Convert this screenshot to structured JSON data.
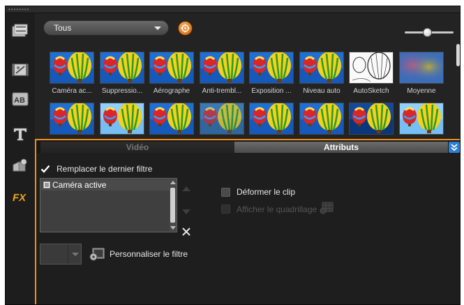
{
  "library": {
    "category_select": "Tous",
    "zoom": {
      "level": 0.45
    },
    "thumbnails": [
      {
        "label": "Caméra ac...",
        "style": "balloon"
      },
      {
        "label": "Suppressio...",
        "style": "balloon"
      },
      {
        "label": "Aérographe",
        "style": "balloon"
      },
      {
        "label": "Anti-trembl...",
        "style": "balloon"
      },
      {
        "label": "Exposition ...",
        "style": "balloon"
      },
      {
        "label": "Niveau auto",
        "style": "balloon"
      },
      {
        "label": "AutoSketch",
        "style": "sketch"
      },
      {
        "label": "Moyenne",
        "style": "blur"
      },
      {
        "label": "",
        "style": "balloon"
      },
      {
        "label": "",
        "style": "balloon-light"
      },
      {
        "label": "",
        "style": "balloon"
      },
      {
        "label": "",
        "style": "balloon-dim"
      },
      {
        "label": "",
        "style": "balloon"
      },
      {
        "label": "",
        "style": "balloon"
      },
      {
        "label": "",
        "style": "balloon-dark"
      },
      {
        "label": "",
        "style": "balloon-light"
      }
    ]
  },
  "sidebar": {
    "items": [
      {
        "name": "media",
        "icon": "media-icon"
      },
      {
        "name": "transitions",
        "icon": "transition-icon"
      },
      {
        "name": "title",
        "icon": "title-icon"
      },
      {
        "name": "text",
        "icon": "text-icon"
      },
      {
        "name": "graphics",
        "icon": "graphic-icon"
      },
      {
        "name": "filters",
        "icon": "fx-icon",
        "text": "FX"
      }
    ]
  },
  "tabs": {
    "video": "Vidéo",
    "attributes": "Attributs"
  },
  "attributes": {
    "replace_last_filter": {
      "label": "Remplacer le dernier filtre",
      "checked": true
    },
    "applied_filters": [
      "Caméra active"
    ],
    "deform_clip": {
      "label": "Déformer le clip",
      "checked": false
    },
    "show_grid": {
      "label": "Afficher le quadrillage",
      "checked": false,
      "enabled": false
    },
    "customize_filter": "Personnaliser le filtre"
  },
  "colors": {
    "accent_border": "#f0901e",
    "collapse_button": "#2c7fd4",
    "background": "#1e1e1e"
  }
}
